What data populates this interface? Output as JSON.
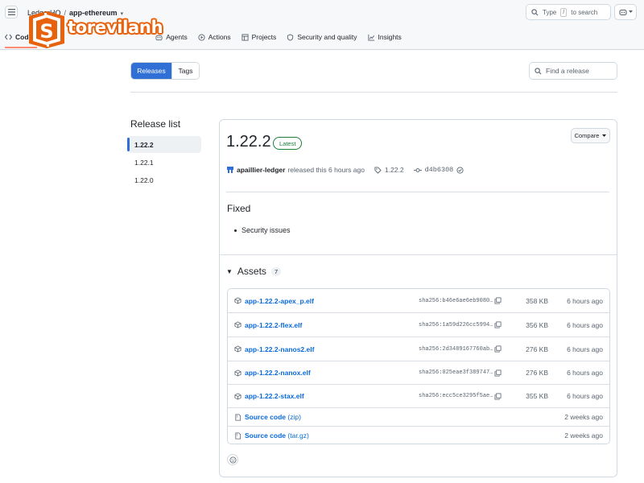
{
  "header": {
    "owner": "LedgerHQ",
    "separator": "/",
    "repo": "app-ethereum",
    "caret": "▾",
    "search_prefix": "Type",
    "search_key": "/",
    "search_suffix": "to search",
    "tabs": [
      {
        "label": "Code",
        "icon": "code-icon"
      },
      {
        "label": "Agents",
        "icon": "agents-icon"
      },
      {
        "label": "Actions",
        "icon": "play-icon"
      },
      {
        "label": "Projects",
        "icon": "table-icon"
      },
      {
        "label": "Security and quality",
        "icon": "shield-icon"
      },
      {
        "label": "Insights",
        "icon": "graph-icon"
      }
    ]
  },
  "logo": {
    "text": "torevilanh",
    "glyph": "S"
  },
  "toolbar": {
    "releases_label": "Releases",
    "tags_label": "Tags",
    "find_placeholder": "Find a release"
  },
  "sidebar": {
    "title": "Release list",
    "items": [
      {
        "label": "1.22.2",
        "selected": true
      },
      {
        "label": "1.22.1",
        "selected": false
      },
      {
        "label": "1.22.0",
        "selected": false
      }
    ]
  },
  "release": {
    "title": "1.22.2",
    "badge": "Latest",
    "compare_label": "Compare",
    "author": "apaillier-ledger",
    "released_text": "released this 6 hours ago",
    "tag": "1.22.2",
    "commit": "d4b6308",
    "section_heading": "Fixed",
    "bullets": [
      "Security issues"
    ],
    "assets_label": "Assets",
    "assets_count": "7",
    "assets": [
      {
        "name": "app-1.22.2-apex_p.elf",
        "sha": "sha256:b46e6ae6eb9080…",
        "size": "358 KB",
        "time": "6 hours ago"
      },
      {
        "name": "app-1.22.2-flex.elf",
        "sha": "sha256:1a59d226cc5994…",
        "size": "356 KB",
        "time": "6 hours ago"
      },
      {
        "name": "app-1.22.2-nanos2.elf",
        "sha": "sha256:2d3489167760ab…",
        "size": "276 KB",
        "time": "6 hours ago"
      },
      {
        "name": "app-1.22.2-nanox.elf",
        "sha": "sha256:025eae3f389747…",
        "size": "276 KB",
        "time": "6 hours ago"
      },
      {
        "name": "app-1.22.2-stax.elf",
        "sha": "sha256:ecc5ce3295f5ae…",
        "size": "355 KB",
        "time": "6 hours ago"
      }
    ],
    "source": [
      {
        "name": "Source code",
        "format": "(zip)",
        "time": "2 weeks ago"
      },
      {
        "name": "Source code",
        "format": "(tar.gz)",
        "time": "2 weeks ago"
      }
    ]
  },
  "colors": {
    "accent": "#2f6fd6",
    "link": "#0969da",
    "latest_green": "#1a7f37",
    "logo_orange": "#e8610c",
    "tab_underline": "#fd8c73"
  }
}
